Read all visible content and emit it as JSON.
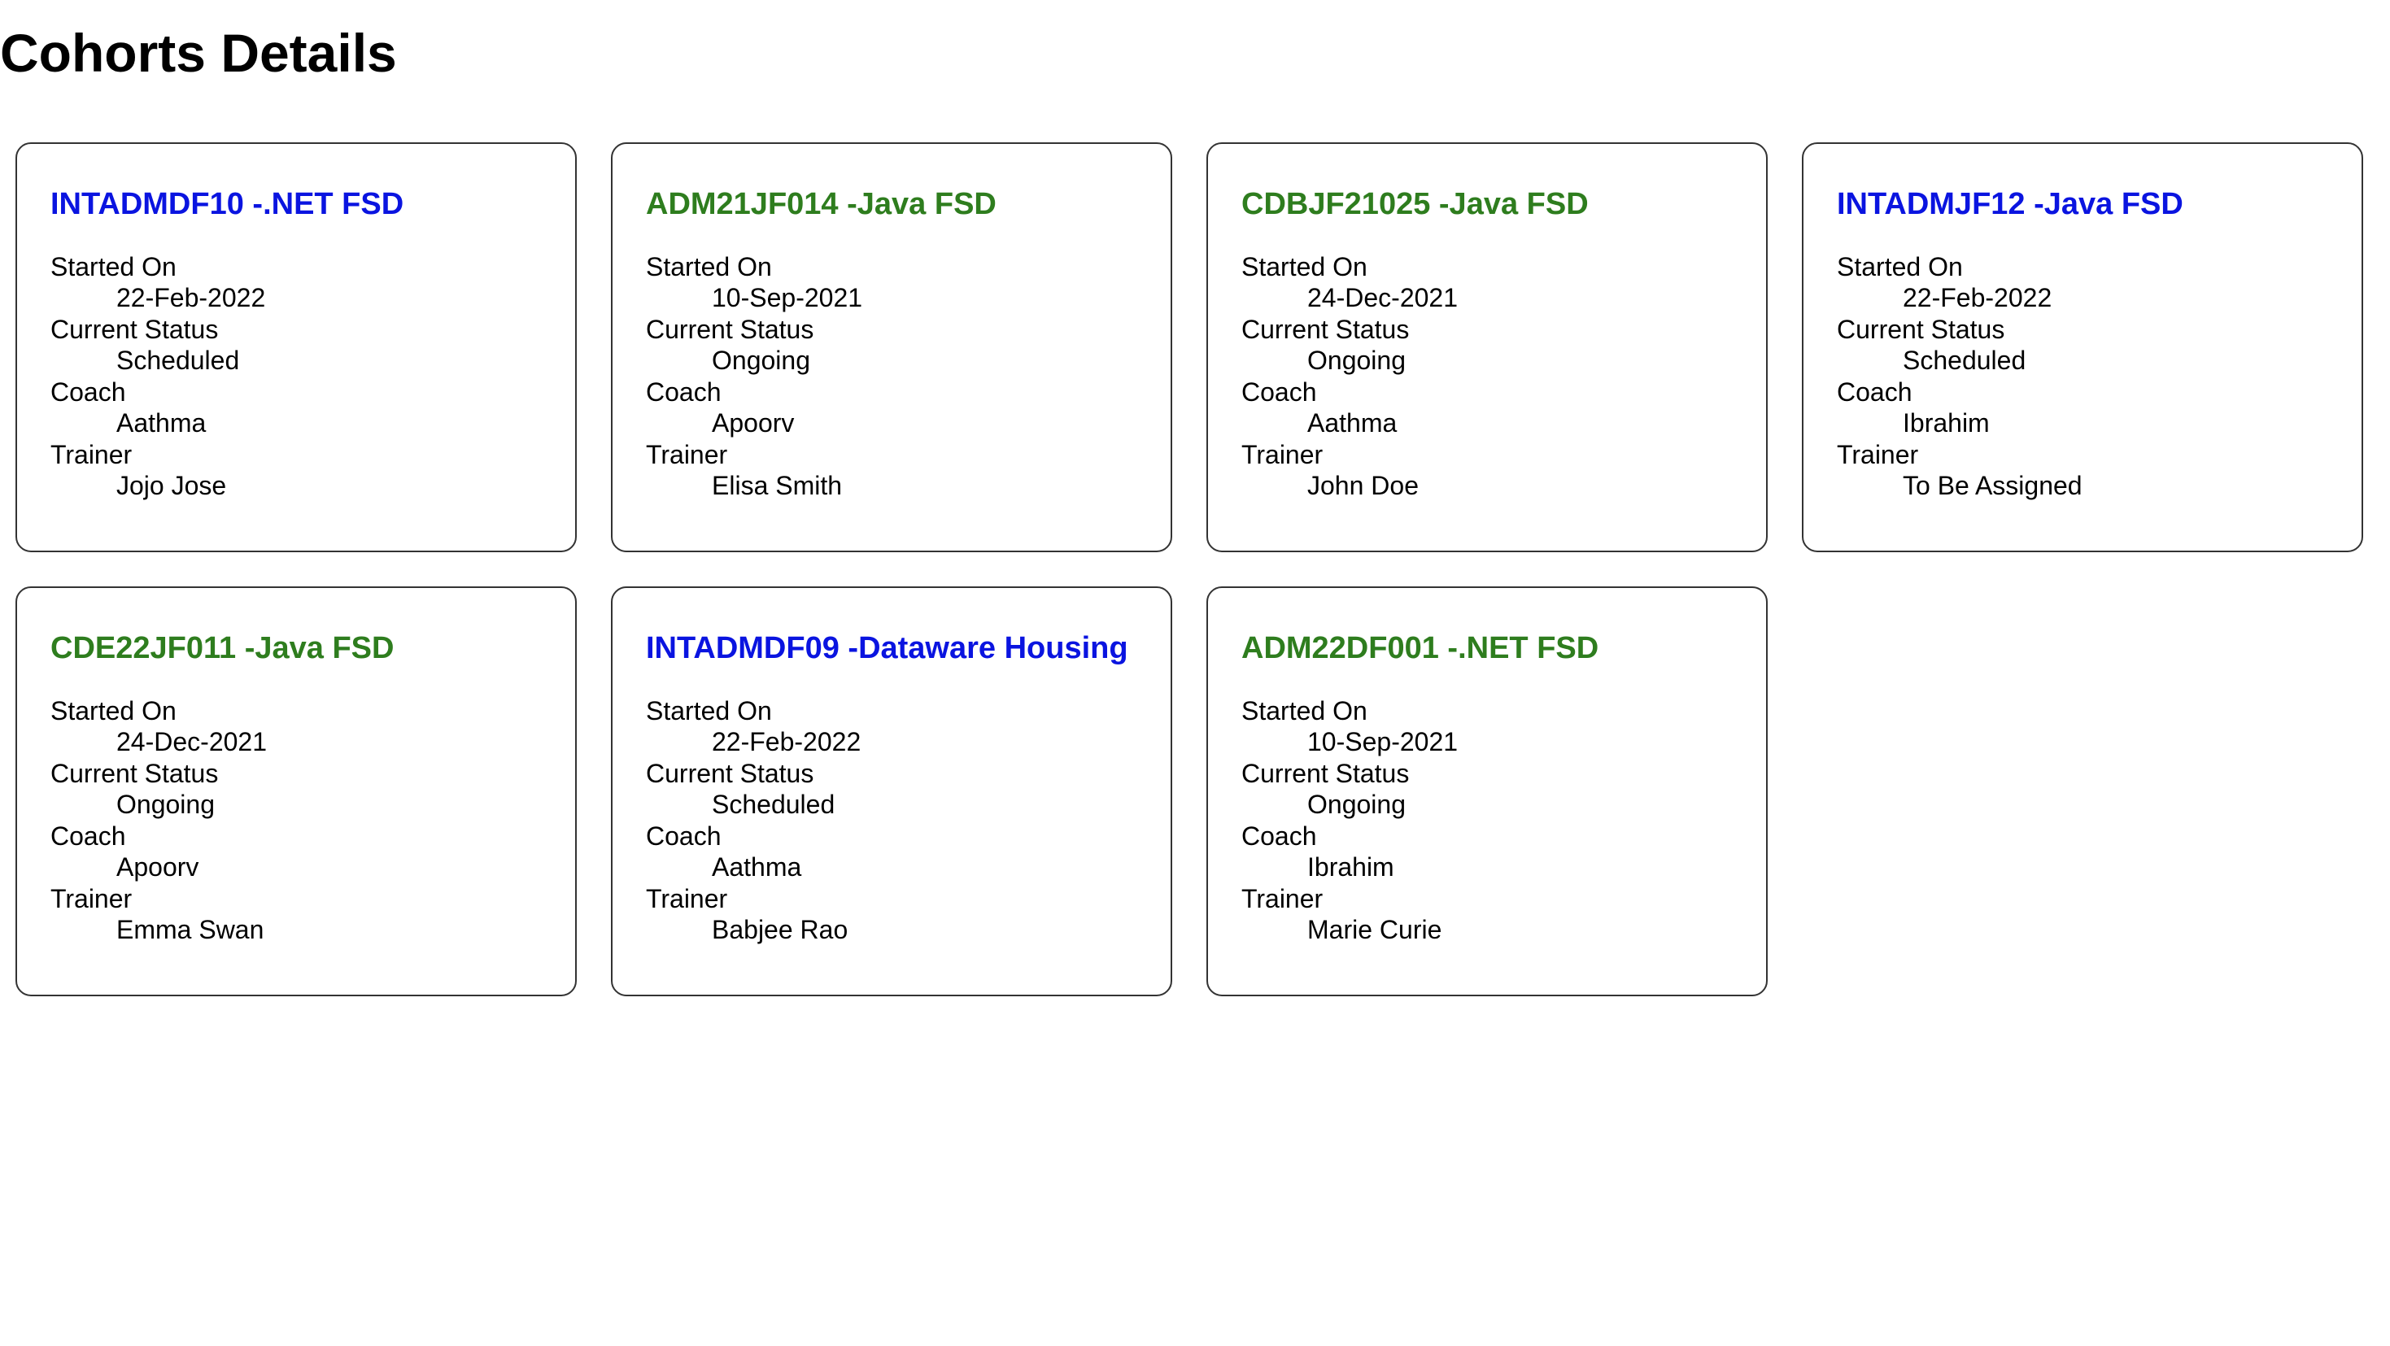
{
  "page": {
    "title": "Cohorts Details"
  },
  "labels": {
    "started_on": "Started On",
    "current_status": "Current Status",
    "coach": "Coach",
    "trainer": "Trainer"
  },
  "colors": {
    "scheduled_title": "#0a14e0",
    "ongoing_title": "#2e7d1e"
  },
  "cohorts": [
    {
      "title": "INTADMDF10 -.NET FSD",
      "started_on": "22-Feb-2022",
      "status": "Scheduled",
      "coach": "Aathma",
      "trainer": "Jojo Jose",
      "title_color": "blue"
    },
    {
      "title": "ADM21JF014 -Java FSD",
      "started_on": "10-Sep-2021",
      "status": "Ongoing",
      "coach": "Apoorv",
      "trainer": "Elisa Smith",
      "title_color": "green"
    },
    {
      "title": "CDBJF21025 -Java FSD",
      "started_on": "24-Dec-2021",
      "status": "Ongoing",
      "coach": "Aathma",
      "trainer": "John Doe",
      "title_color": "green"
    },
    {
      "title": "INTADMJF12 -Java FSD",
      "started_on": "22-Feb-2022",
      "status": "Scheduled",
      "coach": "Ibrahim",
      "trainer": "To Be Assigned",
      "title_color": "blue"
    },
    {
      "title": "CDE22JF011 -Java FSD",
      "started_on": "24-Dec-2021",
      "status": "Ongoing",
      "coach": "Apoorv",
      "trainer": "Emma Swan",
      "title_color": "green"
    },
    {
      "title": "INTADMDF09 -Dataware Housing",
      "started_on": "22-Feb-2022",
      "status": "Scheduled",
      "coach": "Aathma",
      "trainer": "Babjee Rao",
      "title_color": "blue"
    },
    {
      "title": "ADM22DF001 -.NET FSD",
      "started_on": "10-Sep-2021",
      "status": "Ongoing",
      "coach": "Ibrahim",
      "trainer": "Marie Curie",
      "title_color": "green"
    }
  ]
}
